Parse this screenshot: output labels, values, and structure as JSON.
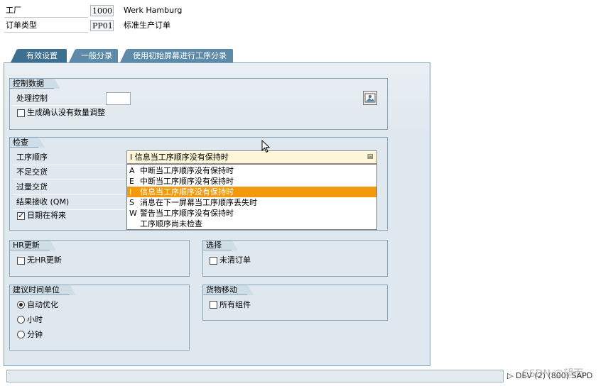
{
  "header": {
    "plant_label": "工厂",
    "plant_code": "1000",
    "plant_name": "Werk Hamburg",
    "order_type_label": "订单类型",
    "order_type_code": "PP01",
    "order_type_name": "标准生产订单"
  },
  "tabs": [
    {
      "label": "有效设置",
      "active": true
    },
    {
      "label": "一般分录",
      "active": false
    },
    {
      "label": "使用初始屏幕进行工序分录",
      "active": false
    }
  ],
  "control_data": {
    "title": "控制数据",
    "processing_control_label": "处理控制",
    "processing_control_value": "",
    "gen_confirm_label": "生成确认没有数量调整",
    "gen_confirm_checked": false,
    "icon": "picture-icon"
  },
  "checks": {
    "title": "检查",
    "operation_sequence_label": "工序顺序",
    "under_delivery_label": "不足交货",
    "over_delivery_label": "过量交货",
    "result_recording_label": "结果接收 (QM)",
    "date_future_label": "日期在将来",
    "date_future_checked": true,
    "dropdown_value": "I 信息当工序顺序没有保持时",
    "dropdown_options": [
      {
        "key": "A",
        "text": "中断当工序顺序没有保持时",
        "selected": false
      },
      {
        "key": "E",
        "text": "中断当工序顺序没有保持时",
        "selected": false
      },
      {
        "key": "I",
        "text": "信息当工序顺序没有保持时",
        "selected": true
      },
      {
        "key": "S",
        "text": "消息在下一屏幕当工序顺序丢失时",
        "selected": false
      },
      {
        "key": "W",
        "text": "警告当工序顺序没有保持时",
        "selected": false
      },
      {
        "key": "",
        "text": "工序顺序尚未检查",
        "selected": false
      }
    ]
  },
  "hr_update": {
    "title": "HR更新",
    "no_hr_update_label": "无HR更新",
    "checked": false
  },
  "selection": {
    "title": "选择",
    "open_orders_label": "未清订单",
    "checked": false
  },
  "time_unit": {
    "title": "建议时间单位",
    "options": [
      {
        "label": "自动优化",
        "checked": true
      },
      {
        "label": "小时",
        "checked": false
      },
      {
        "label": "分钟",
        "checked": false
      }
    ]
  },
  "goods_movement": {
    "title": "货物移动",
    "all_components_label": "所有组件",
    "checked": false
  },
  "statusbar": {
    "system_info": "DEV (2) (800)",
    "server": "SAPD",
    "watermark": "CSDN @望而"
  },
  "colors": {
    "tab_active": "#3f6f8f",
    "tab_inactive": "#5d8aa8",
    "panel_bg": "#dfe8ee",
    "dropdown_selected": "#f29a0c",
    "dropdown_field_bg": "#fdf6d8"
  }
}
